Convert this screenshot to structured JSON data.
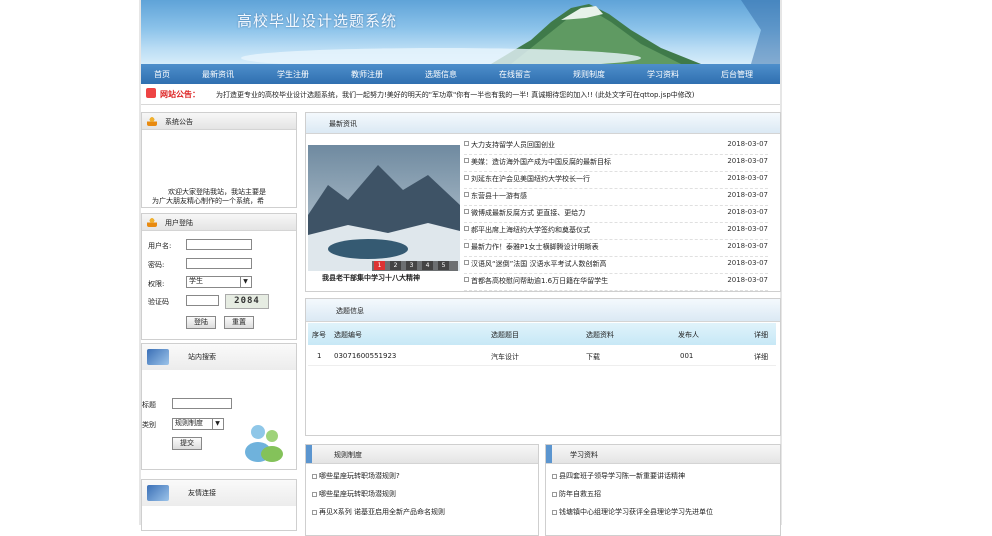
{
  "header": {
    "title": "高校毕业设计选题系统"
  },
  "nav": [
    "首页",
    "最新资讯",
    "学生注册",
    "教师注册",
    "选题信息",
    "在线留言",
    "规则制度",
    "学习资料",
    "后台管理"
  ],
  "notice": {
    "label": "网站公告：",
    "text": "为打造更专业的高校毕业设计选题系统，我们一起努力!美好的明天的\"军功章\"你有一半也有我的一半! 真诚期待您的加入!! (此处文字可在qttop.jsp中修改)"
  },
  "system_notice": {
    "title": "系统公告",
    "line1": "欢迎大家登陆我站，我站主要是",
    "line2": "为广大朋友精心制作的一个系统，希"
  },
  "login": {
    "title": "用户登陆",
    "username_label": "用户名:",
    "password_label": "密码:",
    "role_label": "权限:",
    "role_value": "学生",
    "captcha_label": "验证码",
    "captcha_code": "2084",
    "login_button": "登陆",
    "reset_button": "重置"
  },
  "search": {
    "title": "站内搜索",
    "title_label": "标题",
    "category_label": "类别",
    "category_value": "规则制度",
    "submit_button": "提交"
  },
  "links": {
    "title": "友情连接"
  },
  "news": {
    "title": "最新资讯",
    "image_caption": "我县老干部集中学习十八大精神",
    "slider_pages": [
      "1",
      "2",
      "3",
      "4",
      "5"
    ],
    "items": [
      {
        "title": "大力支持留学人员回国创业",
        "date": "2018-03-07"
      },
      {
        "title": "美媒：造访海外国产成为中国反腐的最新目标",
        "date": "2018-03-07"
      },
      {
        "title": "刘延东在沪会见美国纽约大学校长一行",
        "date": "2018-03-07"
      },
      {
        "title": "东营县十一游有感",
        "date": "2018-03-07"
      },
      {
        "title": "微博成最新反腐方式 更直接、更给力",
        "date": "2018-03-07"
      },
      {
        "title": "郝平出席上海纽约大学签约和奠基仪式",
        "date": "2018-03-07"
      },
      {
        "title": "最新力作！泰雅P1女士横脚腾设计明晰表",
        "date": "2018-03-07"
      },
      {
        "title": "汉语风“迷倒”法国 汉语水平考试人数创新高",
        "date": "2018-03-07"
      },
      {
        "title": "首都各高校慰问帮助逾1.6万日籍在华留学生",
        "date": "2018-03-07"
      }
    ]
  },
  "topics": {
    "title": "选题信息",
    "columns": [
      "序号",
      "选题编号",
      "选题题目",
      "选题资料",
      "发布人",
      "详细"
    ],
    "rows": [
      [
        "1",
        "03071600551923",
        "汽车设计",
        "下载",
        "001",
        "详细"
      ]
    ]
  },
  "rules": {
    "title": "规则制度",
    "items": [
      "哪些星座玩转职场潜规则?",
      "哪些星座玩转职场潜规则",
      "再见X系列 诺基亚启用全新产品命名规则"
    ]
  },
  "materials": {
    "title": "学习资料",
    "items": [
      "县四套班子领导学习陈一新重要讲话精神",
      "防年自救五招",
      "钱塘镇中心组理论学习获评全县理论学习先进单位"
    ]
  }
}
